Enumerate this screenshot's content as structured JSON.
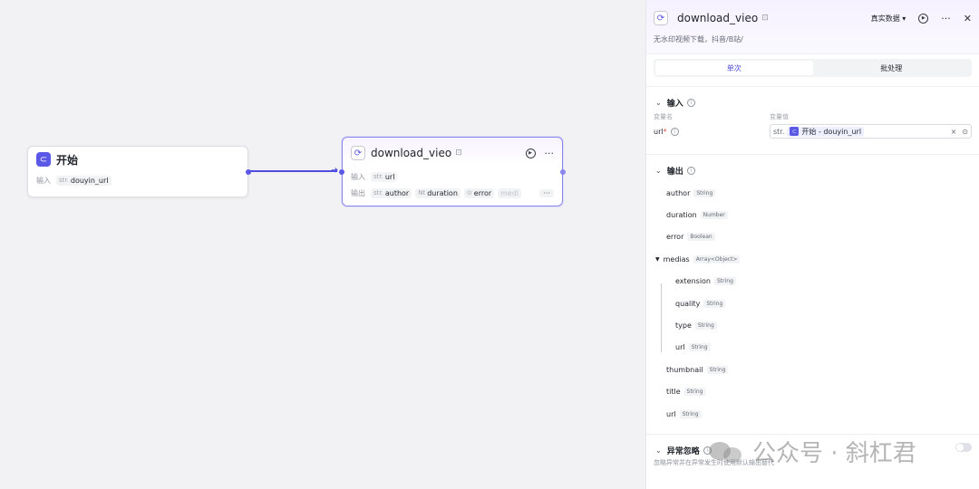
{
  "canvas": {
    "start_node": {
      "title": "开始",
      "input_label": "输入",
      "var_type": "str.",
      "var_name": "douyin_url"
    },
    "dl_node": {
      "title": "download_vieo",
      "input_label": "输入",
      "input_type": "str.",
      "input_var": "url",
      "output_label": "输出",
      "outputs": [
        {
          "type": "str.",
          "name": "author"
        },
        {
          "type": "Nt",
          "name": "duration"
        },
        {
          "type": "",
          "name": "error"
        },
        {
          "type": "",
          "name": "medi"
        }
      ],
      "more": "···"
    }
  },
  "panel": {
    "title": "download_vieo",
    "real_data": "真实数据",
    "description": "无水印视频下载，抖音/B站/",
    "tabs": [
      "单次",
      "批处理"
    ],
    "input_section": "输入",
    "col_var_name": "变量名",
    "col_var_value": "变量值",
    "input_var": "url",
    "input_value_type": "str.",
    "input_ref_node": "开始",
    "input_ref_var": "douyin_url",
    "output_section": "输出",
    "outputs": [
      {
        "name": "author",
        "type": "String"
      },
      {
        "name": "duration",
        "type": "Number"
      },
      {
        "name": "error",
        "type": "Boolean"
      },
      {
        "name": "medias",
        "type": "Array<Object>"
      },
      {
        "name": "extension",
        "type": "String"
      },
      {
        "name": "quality",
        "type": "String"
      },
      {
        "name": "type",
        "type": "String"
      },
      {
        "name": "url",
        "type": "String"
      },
      {
        "name": "thumbnail",
        "type": "String"
      },
      {
        "name": "title",
        "type": "String"
      },
      {
        "name": "url",
        "type": "String"
      }
    ],
    "exception_section": "异常忽略",
    "exception_desc": "忽略异常并在异常发生时使用默认输出替代"
  },
  "watermark": "公众号 · 斜杠君"
}
